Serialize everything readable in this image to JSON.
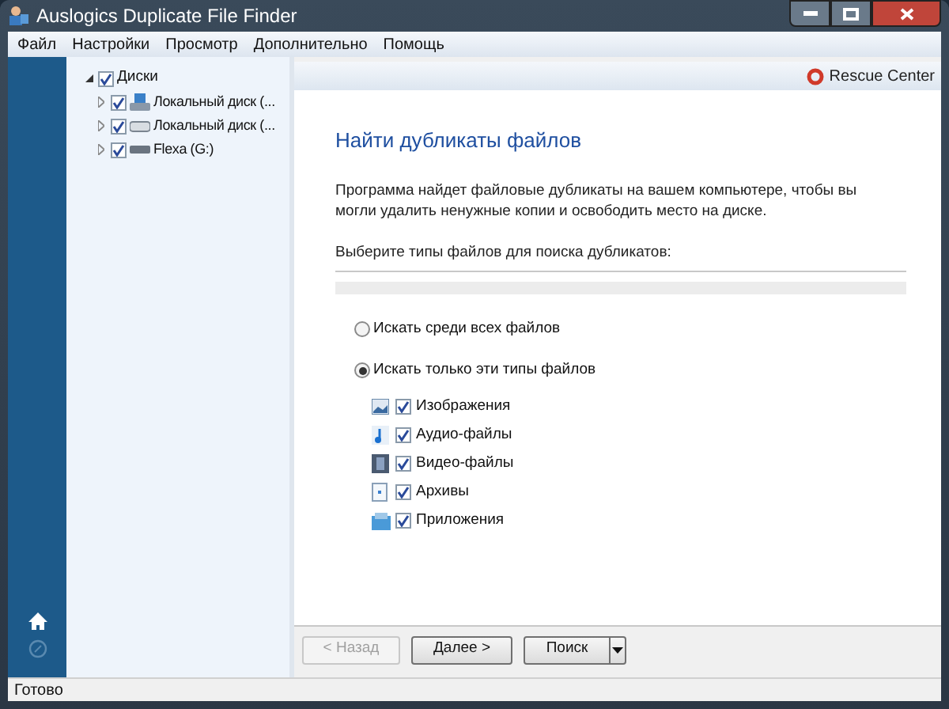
{
  "window": {
    "title": "Auslogics Duplicate File Finder"
  },
  "menu": [
    "Файл",
    "Настройки",
    "Просмотр",
    "Дополнительно",
    "Помощь"
  ],
  "tree": [
    {
      "label": "Диски",
      "checked": true,
      "expanded": true,
      "children": [
        {
          "label": "Локальный диск (...",
          "checked": true,
          "expanded": false,
          "kind": "system"
        },
        {
          "label": "Локальный диск (...",
          "checked": true,
          "expanded": false,
          "kind": "disk"
        },
        {
          "label": "Flexa (G:)",
          "checked": true,
          "expanded": false,
          "kind": "usb"
        }
      ]
    }
  ],
  "rescue_center": "Rescue Center",
  "heading": "Найти дубликаты файлов",
  "description": "Программа найдет файловые дубликаты на вашем компьютере, чтобы вы могли удалить ненужные копии и освободить место на диске.",
  "section_label": "Выберите типы файлов для поиска дубликатов:",
  "modes": [
    {
      "label": "Искать среди всех файлов",
      "selected": false
    },
    {
      "label": "Искать только эти типы файлов",
      "selected": true
    }
  ],
  "file_types": [
    {
      "label": "Изображения",
      "checked": true,
      "kind": "image"
    },
    {
      "label": "Аудио-файлы",
      "checked": true,
      "kind": "audio"
    },
    {
      "label": "Видео-файлы",
      "checked": true,
      "kind": "video"
    },
    {
      "label": "Архивы",
      "checked": true,
      "kind": "archive"
    },
    {
      "label": "Приложения",
      "checked": true,
      "kind": "app"
    }
  ],
  "buttons": [
    {
      "label": "< Назад",
      "disabled": true
    },
    {
      "label": "Далее >",
      "disabled": false
    }
  ],
  "search_button": "Поиск",
  "status_bar": "Готово"
}
